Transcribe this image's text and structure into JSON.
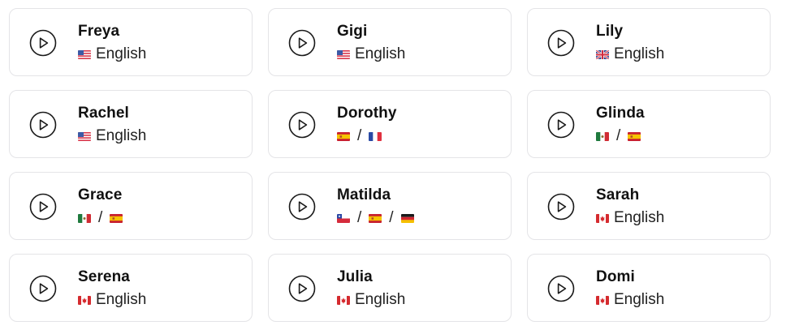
{
  "voices": [
    {
      "name": "Freya",
      "flags": [
        "us-flag-icon"
      ],
      "language": "English"
    },
    {
      "name": "Gigi",
      "flags": [
        "us-flag-icon"
      ],
      "language": "English"
    },
    {
      "name": "Lily",
      "flags": [
        "uk-flag-icon"
      ],
      "language": "English"
    },
    {
      "name": "Rachel",
      "flags": [
        "us-flag-icon"
      ],
      "language": "English"
    },
    {
      "name": "Dorothy",
      "flags": [
        "es-flag-icon",
        "fr-flag-icon"
      ],
      "separator": "/"
    },
    {
      "name": "Glinda",
      "flags": [
        "mx-flag-icon",
        "es-flag-icon"
      ],
      "separator": "/"
    },
    {
      "name": "Grace",
      "flags": [
        "mx-flag-icon",
        "es-flag-icon"
      ],
      "separator": "/"
    },
    {
      "name": "Matilda",
      "flags": [
        "cl-flag-icon",
        "es-flag-icon",
        "de-flag-icon"
      ],
      "separator": "/"
    },
    {
      "name": "Sarah",
      "flags": [
        "ca-flag-icon"
      ],
      "language": "English"
    },
    {
      "name": "Serena",
      "flags": [
        "ca-flag-icon"
      ],
      "language": "English"
    },
    {
      "name": "Julia",
      "flags": [
        "ca-flag-icon"
      ],
      "language": "English"
    },
    {
      "name": "Domi",
      "flags": [
        "ca-flag-icon"
      ],
      "language": "English"
    }
  ],
  "icons": {
    "play": "play-circle-icon"
  },
  "colors": {
    "card_border": "#e4e4e7",
    "text": "#111111"
  }
}
